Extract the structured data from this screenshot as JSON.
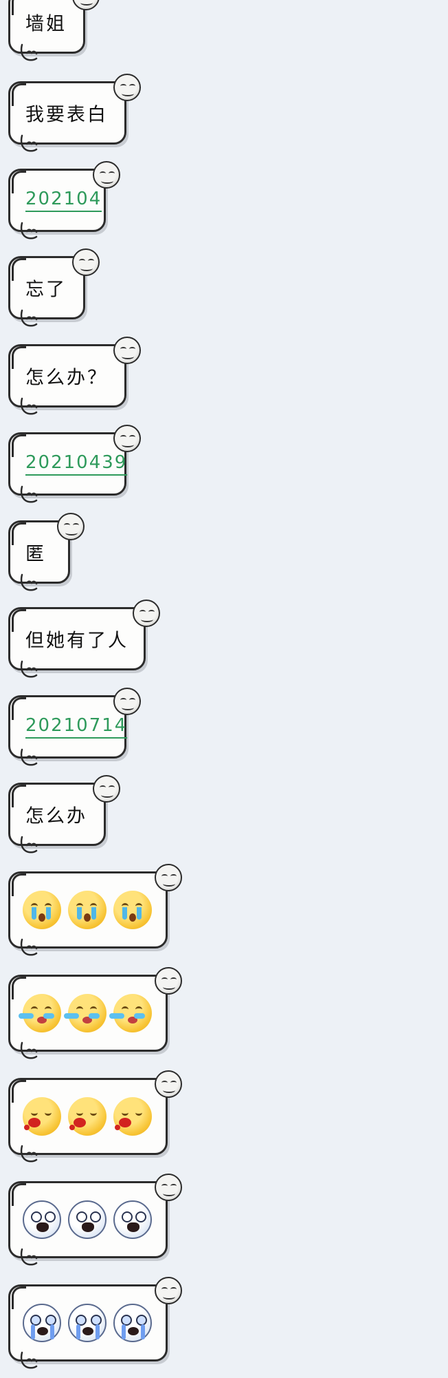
{
  "messages": [
    {
      "type": "text",
      "text": "墙姐"
    },
    {
      "type": "text",
      "text": "我要表白"
    },
    {
      "type": "link",
      "text": "202104"
    },
    {
      "type": "text",
      "text": "忘了"
    },
    {
      "type": "text",
      "text": "怎么办？"
    },
    {
      "type": "link",
      "text": "20210439"
    },
    {
      "type": "text",
      "text": "匿"
    },
    {
      "type": "text",
      "text": "但她有了人"
    },
    {
      "type": "link",
      "text": "20210714"
    },
    {
      "type": "text",
      "text": "怎么办"
    },
    {
      "type": "emoji",
      "emoji": "crying-face-emoji",
      "count": 3
    },
    {
      "type": "emoji",
      "emoji": "loudly-sobbing-face-emoji",
      "count": 3
    },
    {
      "type": "emoji",
      "emoji": "spitting-blood-face-emoji",
      "count": 3
    },
    {
      "type": "emoji",
      "emoji": "screaming-face-emoji",
      "count": 3
    },
    {
      "type": "emoji",
      "emoji": "wailing-face-emoji",
      "count": 3
    }
  ],
  "colors": {
    "background": "#edf1f6",
    "bubble": "#fdfdfc",
    "link_text": "#2e9a5b"
  }
}
